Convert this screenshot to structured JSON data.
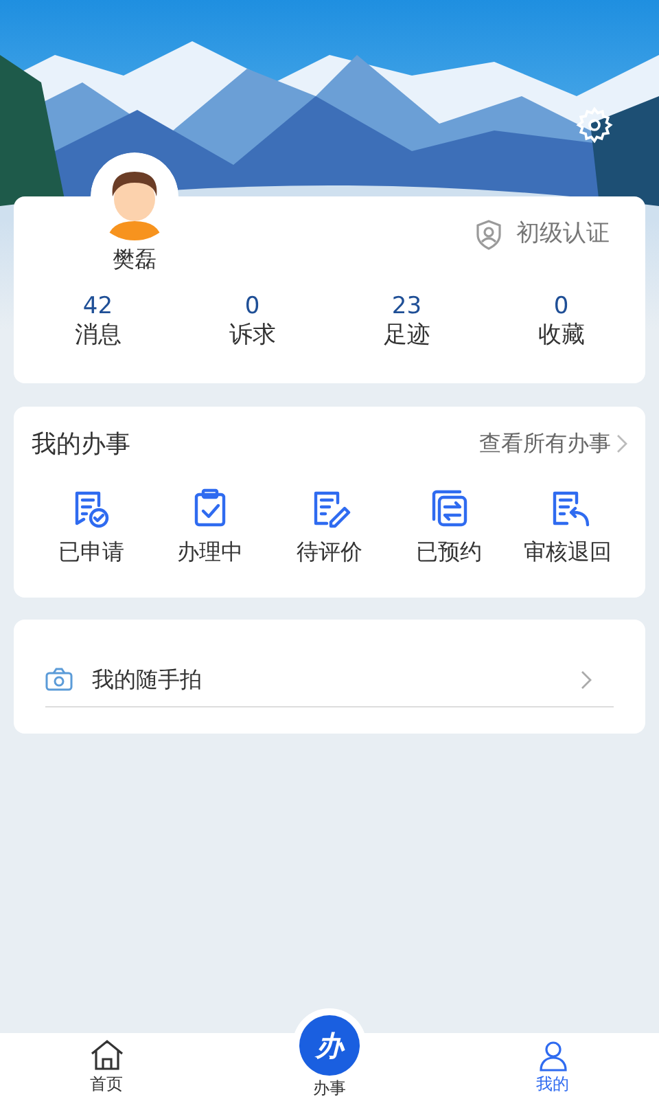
{
  "profile": {
    "name": "樊磊",
    "verification": "初级认证"
  },
  "stats": [
    {
      "value": "42",
      "label": "消息"
    },
    {
      "value": "0",
      "label": "诉求"
    },
    {
      "value": "23",
      "label": "足迹"
    },
    {
      "value": "0",
      "label": "收藏"
    }
  ],
  "my_affairs": {
    "title": "我的办事",
    "view_all": "查看所有办事",
    "items": [
      {
        "kind": "applied",
        "label": "已申请"
      },
      {
        "kind": "processing",
        "label": "办理中"
      },
      {
        "kind": "review",
        "label": "待评价"
      },
      {
        "kind": "booked",
        "label": "已预约"
      },
      {
        "kind": "returned",
        "label": "审核退回"
      }
    ]
  },
  "snapshot": {
    "label": "我的随手拍"
  },
  "bottom_nav": {
    "items": [
      {
        "label": "首页",
        "kind": "home",
        "selected": false
      },
      {
        "label": "办事",
        "kind": "center",
        "badge": "办",
        "selected": false
      },
      {
        "label": "我的",
        "kind": "profile",
        "selected": true
      }
    ]
  }
}
